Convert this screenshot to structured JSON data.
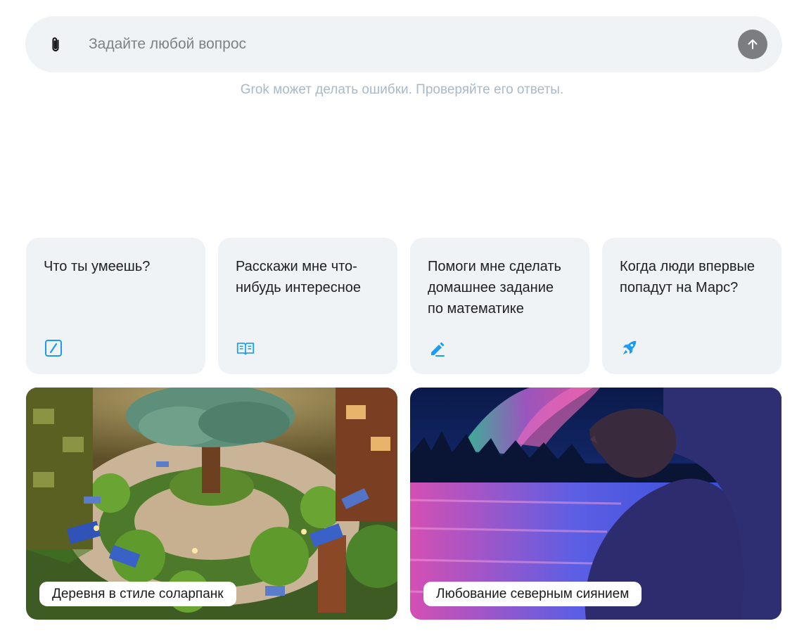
{
  "composer": {
    "placeholder": "Задайте любой вопрос",
    "attach_icon": "paperclip-icon",
    "send_icon": "arrow-up-icon"
  },
  "disclaimer": "Grok может делать ошибки. Проверяйте его ответы.",
  "suggestions": [
    {
      "label": "Что ты умеешь?",
      "icon": "edit-square-icon"
    },
    {
      "label": "Расскажи мне что-нибудь интересное",
      "icon": "open-book-icon"
    },
    {
      "label": "Помоги мне сделать домашнее задание по математике",
      "icon": "pencil-icon"
    },
    {
      "label": "Когда люди впервые попадут на Марс?",
      "icon": "rocket-icon"
    }
  ],
  "image_prompts": [
    {
      "caption": "Деревня в стиле соларпанк"
    },
    {
      "caption": "Любование северным сиянием"
    }
  ],
  "colors": {
    "accent_icon": "#1d9bf0",
    "surface": "#eff3f6",
    "send_button": "#7b7d80",
    "disclaimer_text": "#a9bac6"
  }
}
